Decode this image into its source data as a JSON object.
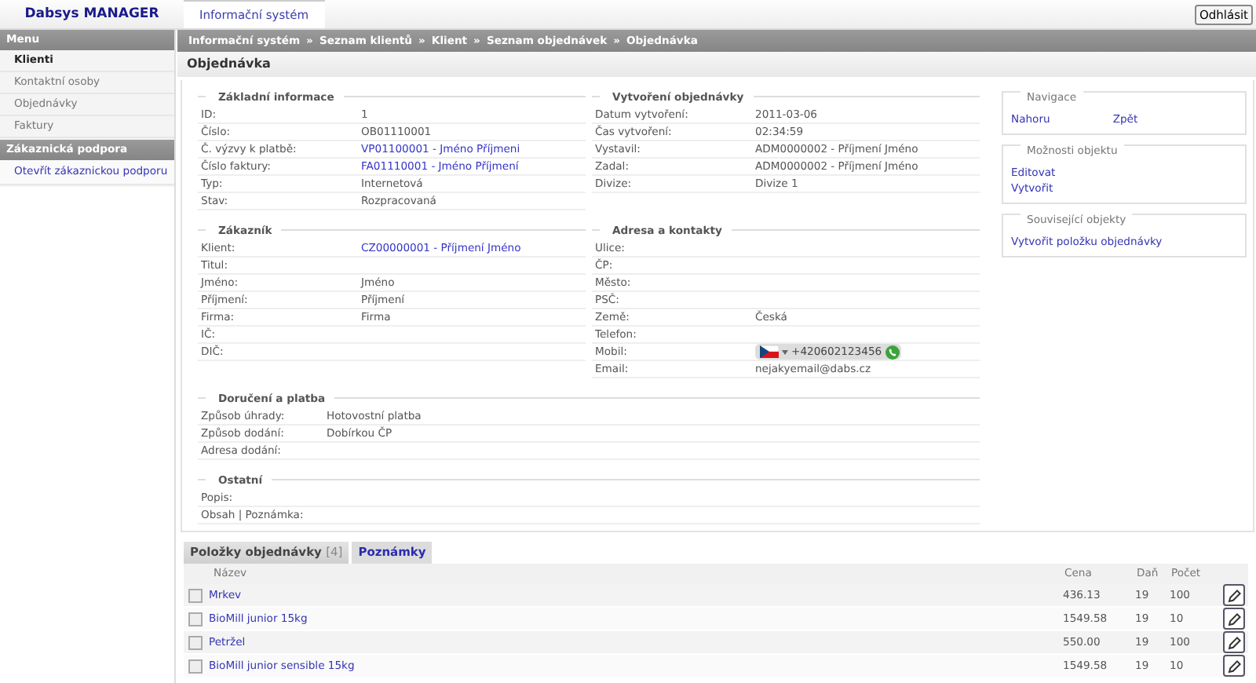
{
  "app_title": "Dabsys MANAGER",
  "top_tabs": [
    {
      "label": "Informační systém",
      "selected": true
    }
  ],
  "logout_button": "Odhlásit",
  "sidebar": [
    {
      "title": "Menu",
      "items": [
        {
          "label": "Klienti",
          "selected": true
        },
        {
          "label": "Kontaktní osoby",
          "selected": false
        },
        {
          "label": "Objednávky",
          "selected": false
        },
        {
          "label": "Faktury",
          "selected": false
        }
      ]
    },
    {
      "title": "Zákaznická podpora",
      "items": [
        {
          "label": "Otevřít zákaznickou podporu",
          "selected": false,
          "kind": "link"
        }
      ]
    }
  ],
  "breadcrumb": {
    "separator": "»",
    "items": [
      "Informační systém",
      "Seznam klientů",
      "Klient",
      "Seznam objednávek",
      "Objednávka"
    ]
  },
  "page_title": "Objednávka",
  "section_rows": [
    [
      {
        "title": "Základní informace",
        "fields": [
          {
            "label": "ID:",
            "value": "1"
          },
          {
            "label": "Číslo:",
            "value": "OB01110001"
          },
          {
            "label": "Č. výzvy k platbě:",
            "value": "VP01100001 - Jméno Příjmeni",
            "kind": "link"
          },
          {
            "label": "Číslo faktury:",
            "value": "FA01110001 - Jméno Příjmení",
            "kind": "link"
          },
          {
            "label": "Typ:",
            "value": "Internetová"
          },
          {
            "label": "Stav:",
            "value": "Rozpracovaná"
          }
        ]
      },
      {
        "title": "Vytvoření objednávky",
        "fields": [
          {
            "label": "Datum vytvoření:",
            "value": "2011-03-06"
          },
          {
            "label": "Čas vytvoření:",
            "value": "02:34:59"
          },
          {
            "label": "Vystavil:",
            "value": "ADM0000002 - Příjmení Jméno"
          },
          {
            "label": "Zadal:",
            "value": "ADM0000002 - Příjmení Jméno"
          },
          {
            "label": "Divize:",
            "value": "Divize 1"
          }
        ]
      }
    ],
    [
      {
        "title": "Zákazník",
        "fields": [
          {
            "label": "Klient:",
            "value": "CZ00000001 - Příjmení Jméno",
            "kind": "link"
          },
          {
            "label": "Titul:"
          },
          {
            "label": "Jméno:",
            "value": "Jméno"
          },
          {
            "label": "Příjmení:",
            "value": "Příjmení"
          },
          {
            "label": "Firma:",
            "value": "Firma"
          },
          {
            "label": "IČ:"
          },
          {
            "label": "DIČ:"
          }
        ]
      },
      {
        "title": "Adresa a kontakty",
        "fields": [
          {
            "label": "Ulice:"
          },
          {
            "label": "ČP:"
          },
          {
            "label": "Město:"
          },
          {
            "label": "PSČ:"
          },
          {
            "label": "Země:",
            "value": "Česká"
          },
          {
            "label": "Telefon:"
          },
          {
            "label": "Mobil:",
            "value": "+420602123456",
            "kind": "phone"
          },
          {
            "label": "Email:",
            "value": "nejakyemail@dabs.cz"
          }
        ]
      }
    ],
    [
      {
        "title": "Doručení a platba",
        "fields": [
          {
            "label": "Způsob úhrady:",
            "value": "Hotovostní platba"
          },
          {
            "label": "Způsob dodání:",
            "value": "Dobírkou ČP"
          },
          {
            "label": "Adresa dodání:"
          }
        ]
      }
    ],
    [
      {
        "title": "Ostatní",
        "fields": [
          {
            "label": "Popis:"
          },
          {
            "label": "Obsah | Poznámka:"
          }
        ]
      }
    ]
  ],
  "side_panels": [
    {
      "title": "Navigace",
      "inline": true,
      "links": [
        "Nahoru",
        "Zpět"
      ]
    },
    {
      "title": "Možnosti objektu",
      "inline": false,
      "links": [
        "Editovat",
        "Vytvořit"
      ]
    },
    {
      "title": "Související objekty",
      "links": [
        "Vytvořit položku objednávky"
      ]
    }
  ],
  "item_tabs": [
    {
      "label": "Položky objednávky",
      "count": "[4]",
      "selected": true
    },
    {
      "label": "Poznámky",
      "selected": false
    }
  ],
  "table": {
    "columns": [
      "Název",
      "Cena",
      "Daň",
      "Počet"
    ],
    "rows": [
      {
        "checked": false,
        "name": "Mrkev",
        "price": "436.13",
        "tax": "19",
        "qty": "100"
      },
      {
        "checked": false,
        "name": "BioMill junior 15kg",
        "price": "1549.58",
        "tax": "19",
        "qty": "10"
      },
      {
        "checked": false,
        "name": "Petržel",
        "price": "550.00",
        "tax": "19",
        "qty": "100"
      },
      {
        "checked": false,
        "name": "BioMill junior sensible 15kg",
        "price": "1549.58",
        "tax": "19",
        "qty": "10"
      }
    ]
  }
}
